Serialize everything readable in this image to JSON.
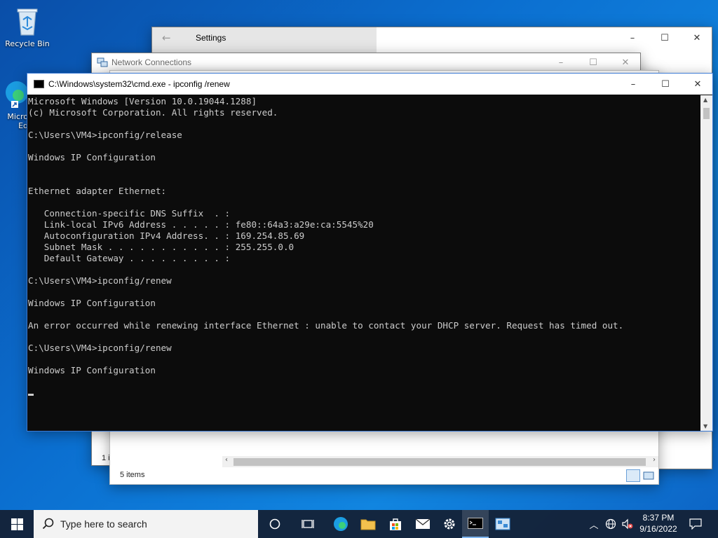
{
  "desktop": {
    "recycle_bin_label": "Recycle Bin",
    "edge_label_line1": "Micro",
    "edge_label_line2": "Ed"
  },
  "settings_window": {
    "title": "Settings",
    "minimize": "–",
    "maximize": "☐",
    "close": "✕"
  },
  "network_window": {
    "title": "Network Connections",
    "minimize": "–",
    "maximize": "☐",
    "close": "✕",
    "status_count": "1 i"
  },
  "explorer_window": {
    "status_items": "5 items"
  },
  "cmd_window": {
    "title": "C:\\Windows\\system32\\cmd.exe - ipconfig /renew",
    "minimize": "–",
    "maximize": "☐",
    "close": "✕",
    "lines": [
      "Microsoft Windows [Version 10.0.19044.1288]",
      "(c) Microsoft Corporation. All rights reserved.",
      "",
      "C:\\Users\\VM4>ipconfig/release",
      "",
      "Windows IP Configuration",
      "",
      "",
      "Ethernet adapter Ethernet:",
      "",
      "   Connection-specific DNS Suffix  . :",
      "   Link-local IPv6 Address . . . . . : fe80::64a3:a29e:ca:5545%20",
      "   Autoconfiguration IPv4 Address. . : 169.254.85.69",
      "   Subnet Mask . . . . . . . . . . . : 255.255.0.0",
      "   Default Gateway . . . . . . . . . :",
      "",
      "C:\\Users\\VM4>ipconfig/renew",
      "",
      "Windows IP Configuration",
      "",
      "An error occurred while renewing interface Ethernet : unable to contact your DHCP server. Request has timed out.",
      "",
      "C:\\Users\\VM4>ipconfig/renew",
      "",
      "Windows IP Configuration",
      "",
      ""
    ]
  },
  "taskbar": {
    "search_placeholder": "Type here to search",
    "time": "8:37 PM",
    "date": "9/16/2022"
  },
  "colors": {
    "console_bg": "#0c0c0c",
    "console_fg": "#cccccc",
    "taskbar_bg": "#142238"
  }
}
